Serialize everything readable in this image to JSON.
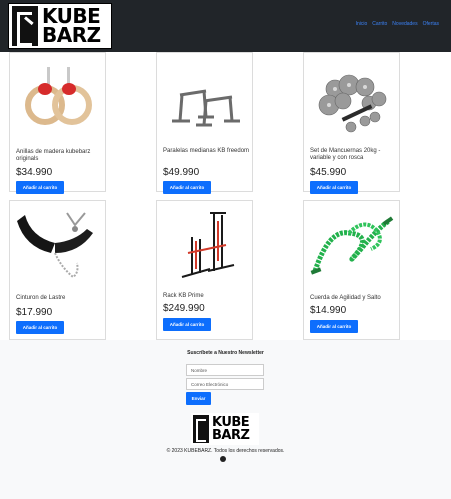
{
  "header": {
    "logo_top": "KUBE",
    "logo_bottom": "BARZ",
    "nav": [
      "Inicio",
      "Carrito",
      "Novedades",
      "Ofertas"
    ]
  },
  "products": [
    {
      "name": "Anillas de madera kubebarz originals",
      "price": "$34.990",
      "button": "Añadir al carrito",
      "icon": "wooden-rings-icon"
    },
    {
      "name": "Paralelas medianas KB freedom",
      "price": "$49.990",
      "button": "Añadir al carrito",
      "icon": "parallettes-icon"
    },
    {
      "name": "Set de Mancuernas 20kg - variable y con rosca",
      "price": "$45.990",
      "button": "Añadir al carrito",
      "icon": "dumbbell-set-icon"
    },
    {
      "name": "Cinturon de Lastre",
      "price": "$17.990",
      "button": "Añadir al carrito",
      "icon": "dip-belt-icon"
    },
    {
      "name": "Rack KB Prime",
      "price": "$249.990",
      "button": "Añadir al carrito",
      "icon": "squat-rack-icon"
    },
    {
      "name": "Cuerda de Agilidad y Salto",
      "price": "$14.990",
      "button": "Añadir al carrito",
      "icon": "jump-rope-icon"
    }
  ],
  "newsletter": {
    "title": "Suscríbete a Nuestro Newsletter",
    "name_placeholder": "Nombre",
    "email_placeholder": "Correo Electrónico",
    "submit": "Enviar"
  },
  "footer": {
    "logo_top": "KUBE",
    "logo_bottom": "BARZ",
    "copyright": "© 2023 KUBEBARZ. Todos los derechos reservados.",
    "social_icon": "github-icon"
  },
  "colors": {
    "topbar": "#212529",
    "accent": "#0d6efd",
    "nav": "#3b82f6"
  }
}
